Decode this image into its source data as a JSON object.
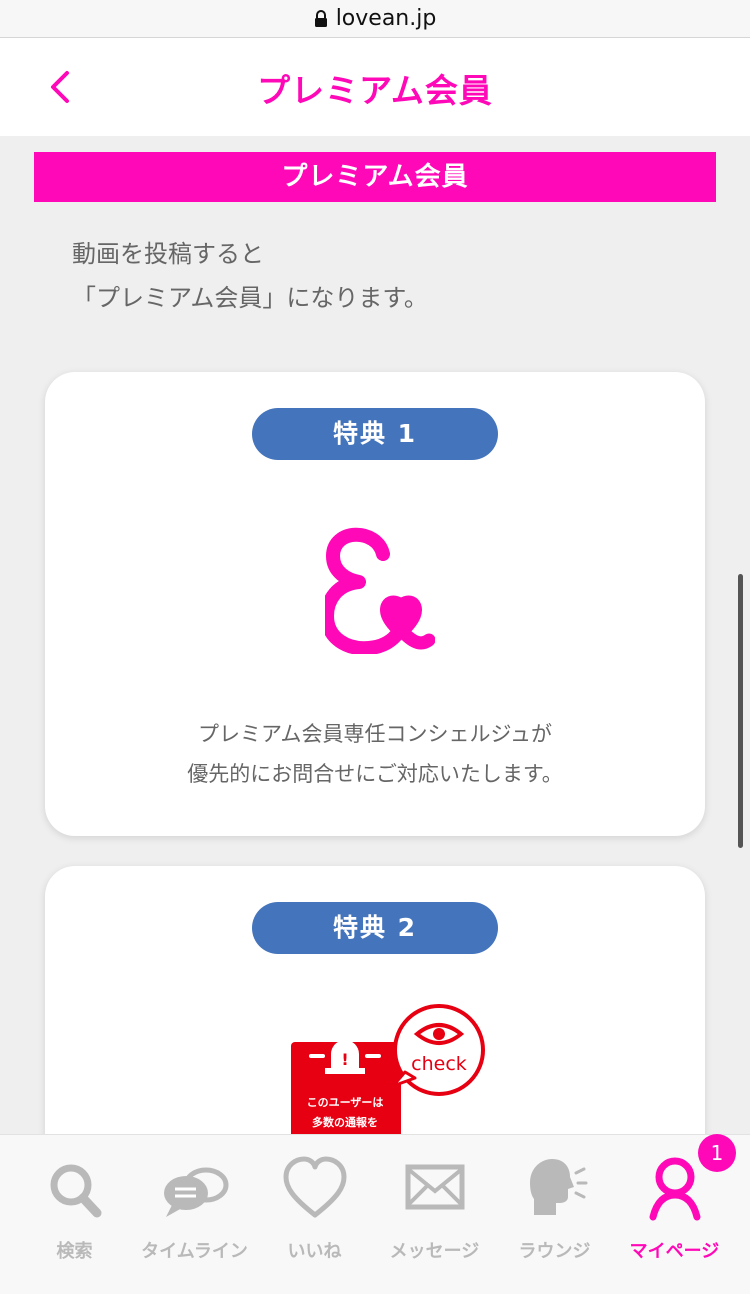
{
  "browser": {
    "url": "lovean.jp"
  },
  "header": {
    "title": "プレミアム会員"
  },
  "section": {
    "title": "プレミアム会員"
  },
  "intro": {
    "line1": "動画を投稿すると",
    "line2": "「プレミアム会員」になります。"
  },
  "benefits": [
    {
      "label": "特典 1",
      "icon": "ampersand-heart-logo",
      "desc_line1": "プレミアム会員専任コンシェルジュが",
      "desc_line2": "優先的にお問合せにご対応いたします。"
    },
    {
      "label": "特典 2",
      "icon": "alert-check-graphic",
      "graphic_text_check": "check",
      "graphic_text_line1": "このユーザーは",
      "graphic_text_line2": "多数の通報を"
    }
  ],
  "bottom_nav": {
    "items": [
      {
        "label": "検索",
        "icon": "search-icon"
      },
      {
        "label": "タイムライン",
        "icon": "chat-bubbles-icon"
      },
      {
        "label": "いいね",
        "icon": "heart-icon"
      },
      {
        "label": "メッセージ",
        "icon": "envelope-icon"
      },
      {
        "label": "ラウンジ",
        "icon": "speaking-head-icon"
      },
      {
        "label": "マイページ",
        "icon": "person-icon",
        "active": true
      }
    ],
    "badge_count": "1"
  },
  "colors": {
    "accent": "#ff08b8",
    "pill": "#4474bb",
    "alert": "#e60012",
    "inactive": "#b9b9b9"
  }
}
